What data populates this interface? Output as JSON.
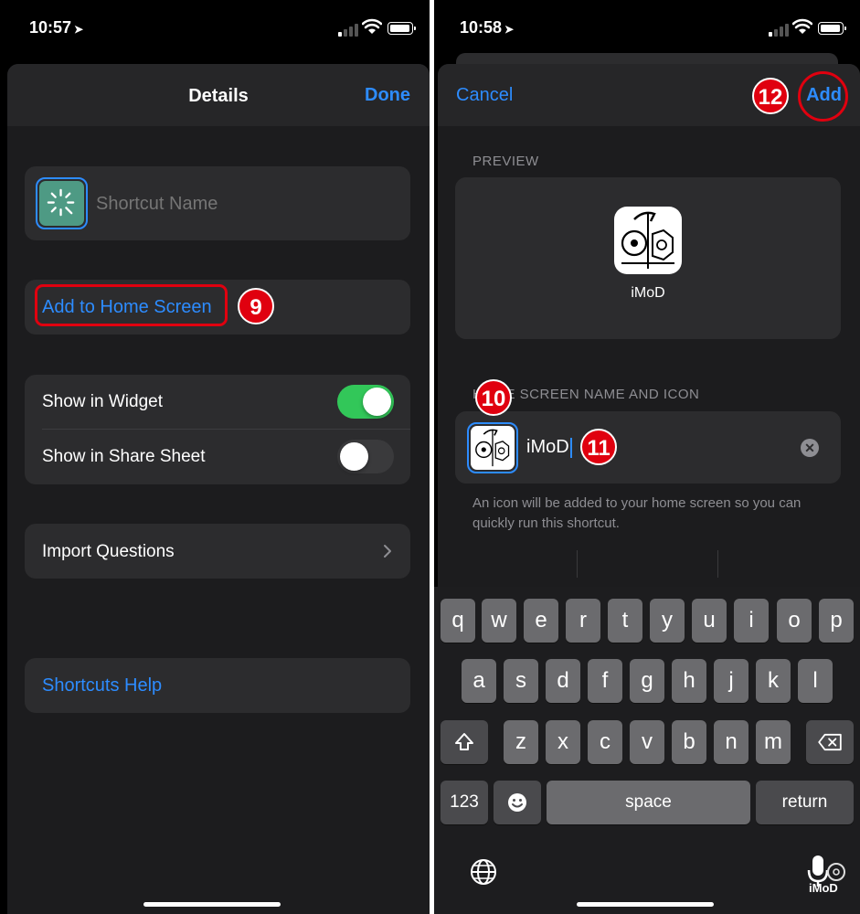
{
  "left": {
    "status": {
      "time": "10:57"
    },
    "nav": {
      "title": "Details",
      "done": "Done"
    },
    "name_placeholder": "Shortcut Name",
    "add_home": "Add to Home Screen",
    "badge_9": "9",
    "toggles": [
      {
        "label": "Show in Widget",
        "on": true
      },
      {
        "label": "Show in Share Sheet",
        "on": false
      }
    ],
    "import_label": "Import Questions",
    "help_label": "Shortcuts Help"
  },
  "right": {
    "status": {
      "time": "10:58"
    },
    "nav": {
      "cancel": "Cancel",
      "add": "Add"
    },
    "badge_10": "10",
    "badge_11": "11",
    "badge_12": "12",
    "preview_header": "PREVIEW",
    "preview_app_name": "iMoD",
    "section_header": "HOME SCREEN NAME AND ICON",
    "name_value": "iMoD",
    "description": "An icon will be added to your home screen so you can quickly run this shortcut.",
    "keyboard": {
      "row1": [
        "q",
        "w",
        "e",
        "r",
        "t",
        "y",
        "u",
        "i",
        "o",
        "p"
      ],
      "row2": [
        "a",
        "s",
        "d",
        "f",
        "g",
        "h",
        "j",
        "k",
        "l"
      ],
      "row3": [
        "z",
        "x",
        "c",
        "v",
        "b",
        "n",
        "m"
      ],
      "numbers": "123",
      "space": "space",
      "return": "return"
    },
    "watermark": "iMoD"
  },
  "colors": {
    "accent": "#2d8cff",
    "toggle_on": "#32c759",
    "callout": "#e0000f",
    "card": "#2c2c2e",
    "sheet": "#1c1c1e"
  }
}
